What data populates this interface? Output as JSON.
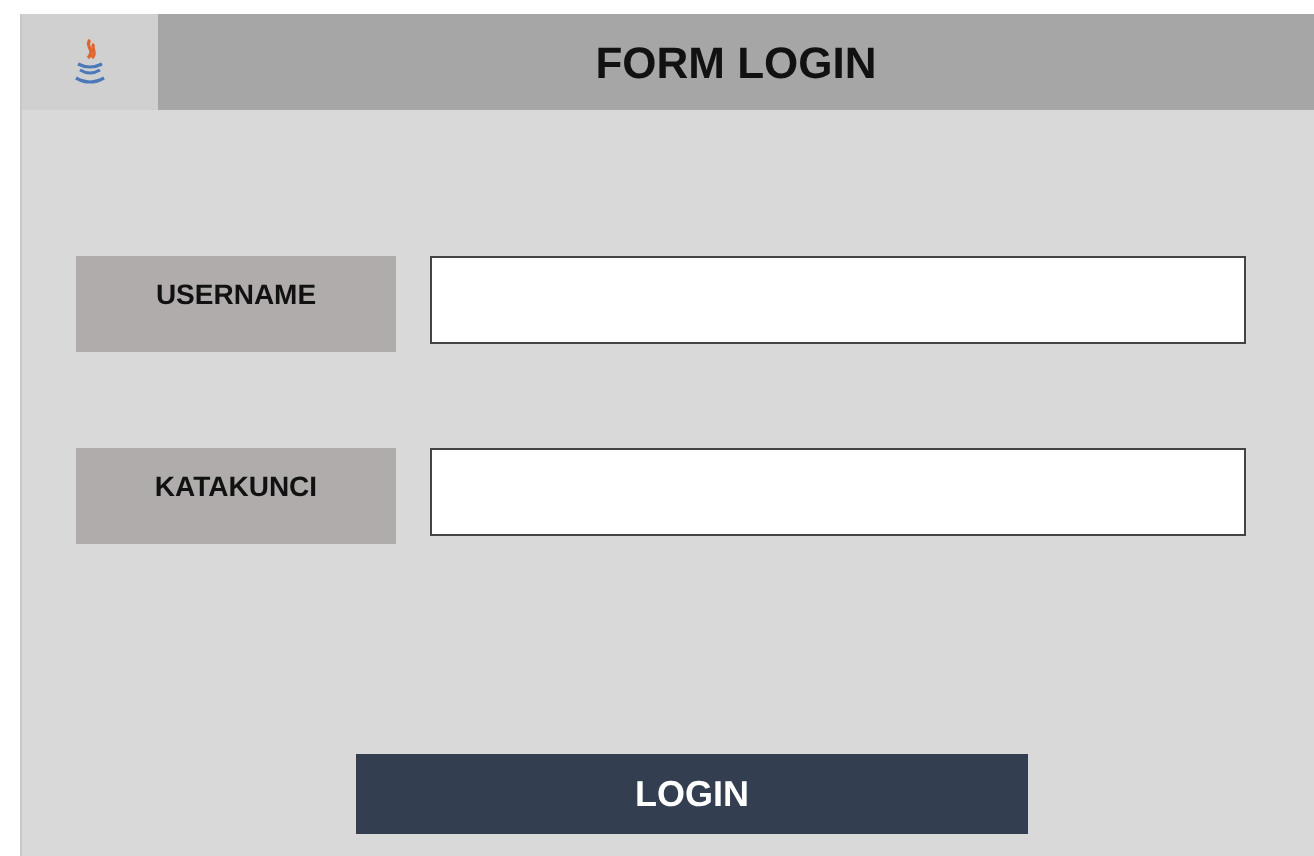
{
  "window": {
    "title": "FORM LOGIN"
  },
  "fields": [
    {
      "label": "USERNAME"
    },
    {
      "label": "KATAKUNCI"
    }
  ],
  "button": {
    "label": "LOGIN"
  }
}
